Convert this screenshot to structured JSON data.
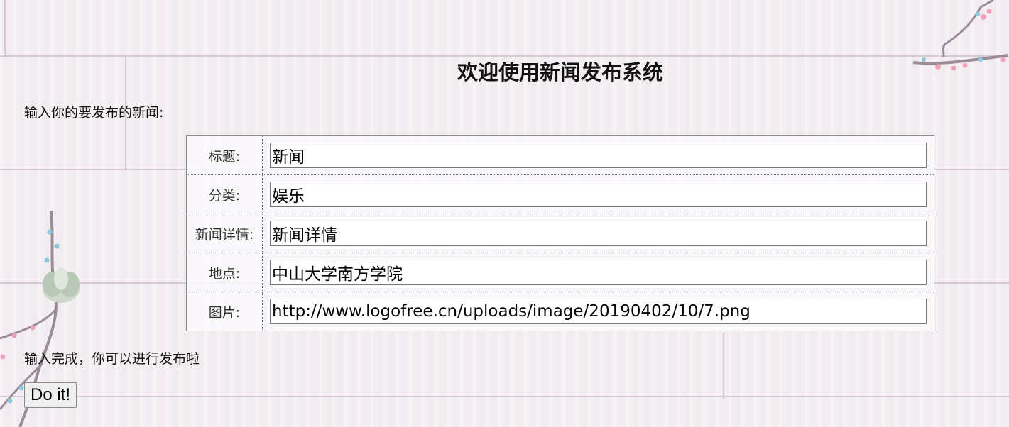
{
  "header": {
    "title": "欢迎使用新闻发布系统"
  },
  "intro_text": "输入你的要发布的新闻:",
  "form": {
    "fields": [
      {
        "label": "标题:",
        "value": "新闻"
      },
      {
        "label": "分类:",
        "value": "娱乐"
      },
      {
        "label": "新闻详情:",
        "value": "新闻详情"
      },
      {
        "label": "地点:",
        "value": "中山大学南方学院"
      },
      {
        "label": "图片:",
        "value": "http://www.logofree.cn/uploads/image/20190402/10/7.png"
      }
    ]
  },
  "done_text": "输入完成，你可以进行发布啦",
  "submit_label": "Do it!",
  "decorations": {
    "left": "plum-branch-with-flower-icon",
    "top_right": "plum-branch-icon",
    "branch_color": "#9a8c94",
    "blossom_color": "#f2a0b8",
    "bud_color": "#8cc8dc"
  }
}
